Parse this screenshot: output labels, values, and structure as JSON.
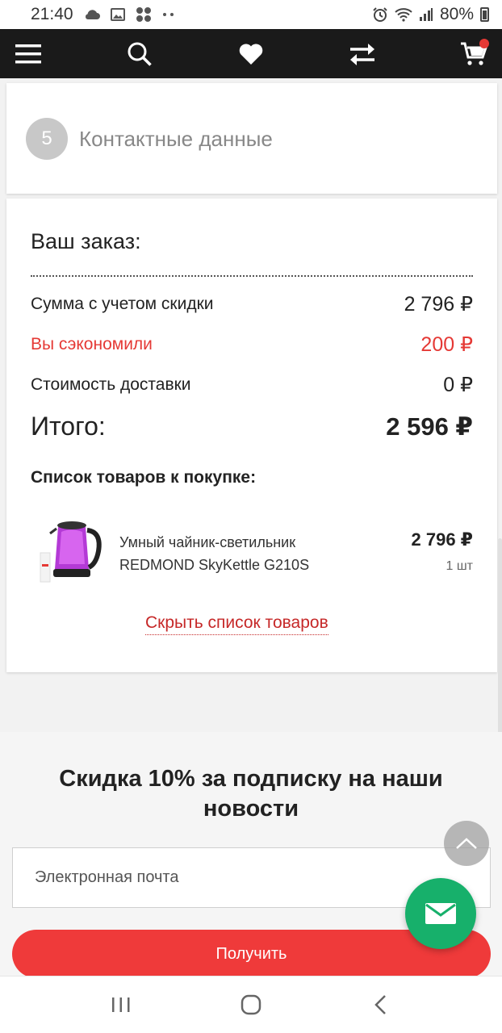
{
  "status_bar": {
    "time": "21:40",
    "battery": "80%",
    "icons": [
      "cloud-icon",
      "image-icon",
      "app-icon",
      "more-icon",
      "alarm-icon",
      "wifi-icon",
      "signal-icon",
      "battery-icon"
    ]
  },
  "app_bar": {
    "icons": [
      "menu-icon",
      "search-icon",
      "heart-icon",
      "compare-icon",
      "cart-icon"
    ],
    "cart_badge_color": "#e53935"
  },
  "step": {
    "number": "5",
    "title": "Контактные данные"
  },
  "order": {
    "heading": "Ваш заказ:",
    "discounted_sum_label": "Сумма с учетом скидки",
    "discounted_sum_value": "2 796 ₽",
    "saved_label": "Вы сэкономили",
    "saved_value": "200 ₽",
    "delivery_label": "Стоимость доставки",
    "delivery_value": "0 ₽",
    "total_label": "Итого:",
    "total_value": "2 596 ₽",
    "list_title": "Список товаров к покупке:",
    "items": [
      {
        "name": "Умный чайник-светильник REDMOND SkyKettle G210S",
        "price": "2 796 ₽",
        "quantity": "1 шт"
      }
    ],
    "hide_list_link": "Скрыть список товаров"
  },
  "newsletter": {
    "title": "Скидка 10% за подписку на наши новости",
    "email_placeholder": "Электронная почта",
    "submit_label": "Получить"
  },
  "colors": {
    "accent_red": "#ef3a3a",
    "fab_green": "#17b06b",
    "app_bar": "#1a1a1a"
  }
}
